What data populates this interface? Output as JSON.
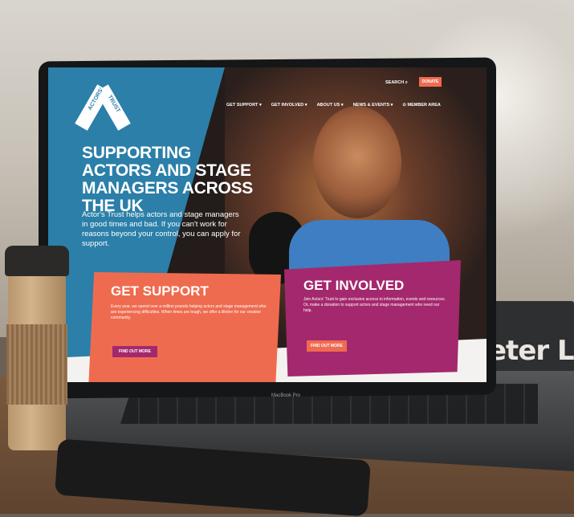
{
  "site": {
    "nav": [
      "GET SUPPORT ▾",
      "GET INVOLVED ▾",
      "ABOUT US ▾",
      "NEWS & EVENTS ▾",
      "⊙ MEMBER AREA"
    ],
    "search_label": "SEARCH",
    "donate_label": "DONATE",
    "logo_text": [
      "ACTORS'",
      "TRUST"
    ],
    "headline": "SUPPORTING ACTORS AND STAGE MANAGERS ACROSS THE UK",
    "intro": "Actor's Trust helps actors and stage managers in good times and bad. If you can't work for reasons beyond your control, you can apply for support.",
    "support_card": {
      "title": "GET SUPPORT",
      "body": "Every year, we spend over a million pounds helping actors and stage management who are experiencing difficulties. When times are tough, we offer a lifeline for our creative community.",
      "button": "FIND OUT MORE"
    },
    "involved_card": {
      "title": "GET INVOLVED",
      "body": "Join Actors' Trust to gain exclusive access to information, events and resources. Or, make a donation to support actors and stage management who need our help.",
      "button": "FIND OUT MORE"
    }
  },
  "laptop_label": "MacBook Pro",
  "book_title": "eter Lin",
  "colors": {
    "blue": "#2b7fa8",
    "coral": "#ef6b4f",
    "magenta": "#a4286d"
  }
}
